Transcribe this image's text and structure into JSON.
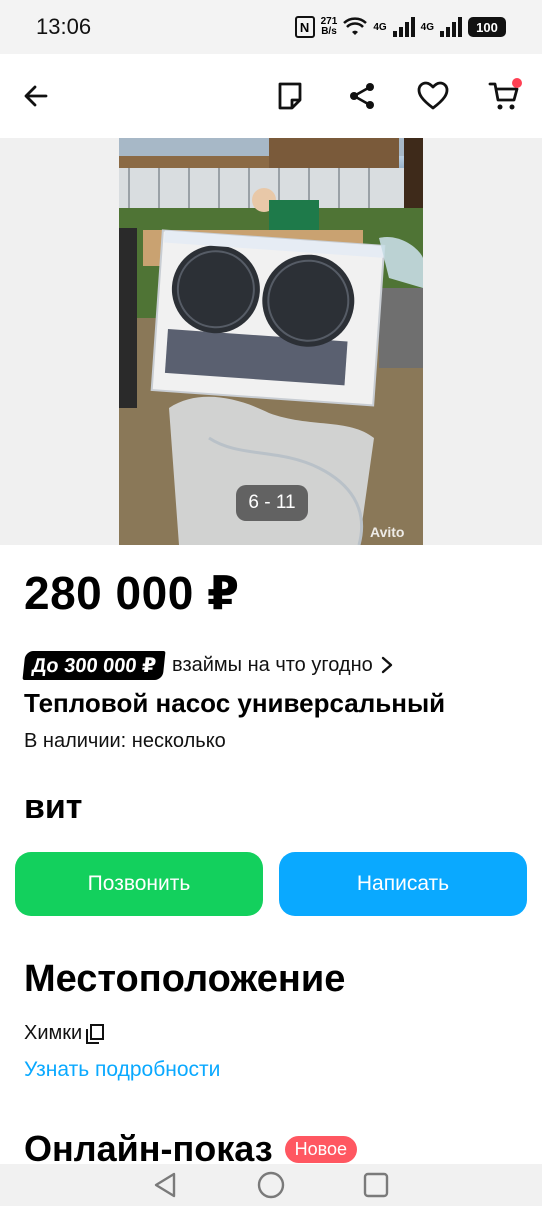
{
  "status_bar": {
    "time": "13:06",
    "nfc": "N",
    "net_speed_value": "271",
    "net_speed_unit": "B/s",
    "net1": "4G",
    "net2": "4G",
    "battery": "100"
  },
  "top_bar": {
    "back_icon": "arrow-left-icon",
    "note_icon": "note-icon",
    "share_icon": "share-icon",
    "favorite_icon": "heart-icon",
    "cart_icon": "cart-icon",
    "cart_dot_color": "#ff4053"
  },
  "gallery": {
    "counter": "6 - 11",
    "watermark": "Avito"
  },
  "listing": {
    "price": "280 000 ₽",
    "loan_badge": "До 300 000 ₽",
    "loan_text": "взаймы на что угодно",
    "title": "Тепловой насос универсальный",
    "availability": "В наличии: несколько",
    "cut_text": "вит"
  },
  "actions": {
    "call_label": "Позвонить",
    "write_label": "Написать",
    "call_color": "#13d05d",
    "write_color": "#0aa9ff"
  },
  "location": {
    "heading": "Местоположение",
    "city": "Химки",
    "details_link": "Узнать подробности"
  },
  "online_show": {
    "heading": "Онлайн-показ",
    "badge": "Новое"
  },
  "nav_bar": {
    "back_icon": "triangle-back-icon",
    "home_icon": "circle-home-icon",
    "recents_icon": "square-recents-icon"
  }
}
